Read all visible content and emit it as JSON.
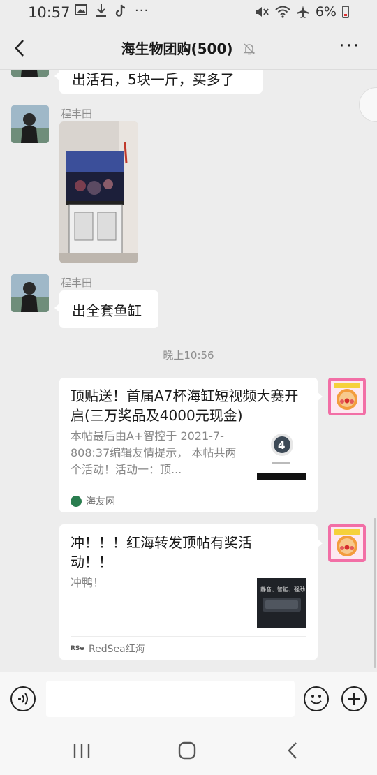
{
  "status_bar": {
    "time": "10:57",
    "battery": "6%",
    "icons_left": [
      "gallery-icon",
      "download-icon",
      "tiktok-icon",
      "more-dots-icon"
    ],
    "icons_right": [
      "mute-icon",
      "wifi-icon",
      "airplane-icon",
      "battery-icon"
    ]
  },
  "header": {
    "title": "海生物团购(500)",
    "back_icon": "back-arrow-icon",
    "mute_icon": "bell-off-icon",
    "more_icon": "more-icon"
  },
  "messages": [
    {
      "type": "text",
      "side": "left",
      "text": "出活石，5块一斤，买多了"
    },
    {
      "type": "image",
      "side": "left",
      "sender": "程丰田",
      "image_desc": "aquarium-photo"
    },
    {
      "type": "text",
      "side": "left",
      "sender": "程丰田",
      "text": "出全套鱼缸"
    }
  ],
  "time_separator": "晚上10:56",
  "cards": [
    {
      "title": "顶贴送！首届A7杯海缸短视频大赛开启(三万奖品及4000元现金)",
      "desc": "本帖最后由A+智控于 2021-7-808:37编辑友情提示， 本帖共两个活动！活动一：顶...",
      "source": "海友网"
    },
    {
      "title": "冲！！！红海转发顶帖有奖活动！！",
      "desc": "冲鸭！",
      "source": "RedSea红海",
      "thumb_text": "静音、智能、强劲"
    }
  ],
  "input_bar": {
    "voice_icon": "voice-icon",
    "emoji_icon": "emoji-icon",
    "plus_icon": "plus-icon",
    "placeholder": ""
  },
  "system_nav": [
    "recents-icon",
    "home-icon",
    "back-icon"
  ]
}
